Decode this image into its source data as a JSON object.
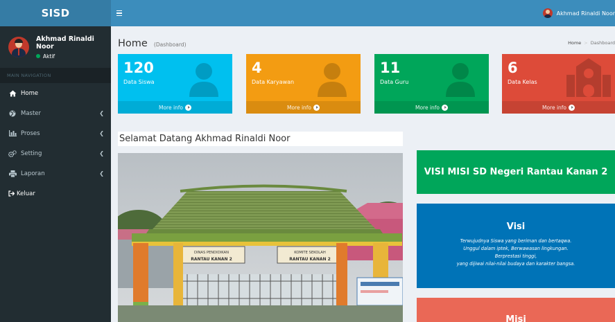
{
  "app": {
    "logo": "SISD"
  },
  "sidebar": {
    "user": {
      "name": "Akhmad Rinaldi Noor",
      "status": "Aktif"
    },
    "nav_header": "MAIN NAVIGATION",
    "items": [
      {
        "label": "Home",
        "icon": "home-icon"
      },
      {
        "label": "Master",
        "icon": "globe-icon",
        "arrow": "❮"
      },
      {
        "label": "Proses",
        "icon": "bar-chart-icon",
        "arrow": "❮"
      },
      {
        "label": "Setting",
        "icon": "gears-icon",
        "arrow": "❮"
      },
      {
        "label": "Laporan",
        "icon": "print-icon",
        "arrow": "❮"
      },
      {
        "label": "Keluar",
        "icon": "sign-out-icon"
      }
    ]
  },
  "topbar": {
    "user_name": "Akhmad Rinaldi Noor"
  },
  "header": {
    "title": "Home",
    "subtitle": "Dashboard",
    "breadcrumb": [
      "Home",
      "Dashboard"
    ]
  },
  "stats": [
    {
      "value": "120",
      "label": "Data Siswa",
      "more": "More info",
      "color": "#00c0ef",
      "icon": "user-icon"
    },
    {
      "value": "4",
      "label": "Data Karyawan",
      "more": "More info",
      "color": "#f39c12",
      "icon": "user-icon"
    },
    {
      "value": "11",
      "label": "Data Guru",
      "more": "More info",
      "color": "#00a65a",
      "icon": "user-icon"
    },
    {
      "value": "6",
      "label": "Data Kelas",
      "more": "More info",
      "color": "#dd4b39",
      "icon": "school-icon"
    }
  ],
  "welcome": "Selamat Datang Akhmad Rinaldi Noor",
  "photo_signs": {
    "left_line1": "DINAS PENDIDIKAN",
    "left_line2": "RANTAU KANAN 2",
    "right_line1": "KOMITE SEKOLAH",
    "right_line2": "RANTAU KANAN 2"
  },
  "visi_misi": {
    "title": "VISI MISI SD Negeri Rantau Kanan 2",
    "visi_heading": "Visi",
    "visi_lines": [
      "Terwujudnya Siswa yang beriman dan bertaqwa.",
      "Unggul dalam iptek, Berwawasan lingkungan.",
      "Berprestasi tinggi,",
      "yang dijiwai nilai-nilai budaya dan karakter bangsa."
    ],
    "misi_heading": "Misi"
  },
  "colors": {
    "sidebar": "#222d32",
    "topbar": "#3c8dbc",
    "logo": "#357ca5",
    "visi_title": "#00a65a",
    "visi_box": "#0073b7",
    "misi_box": "#ea6856"
  }
}
